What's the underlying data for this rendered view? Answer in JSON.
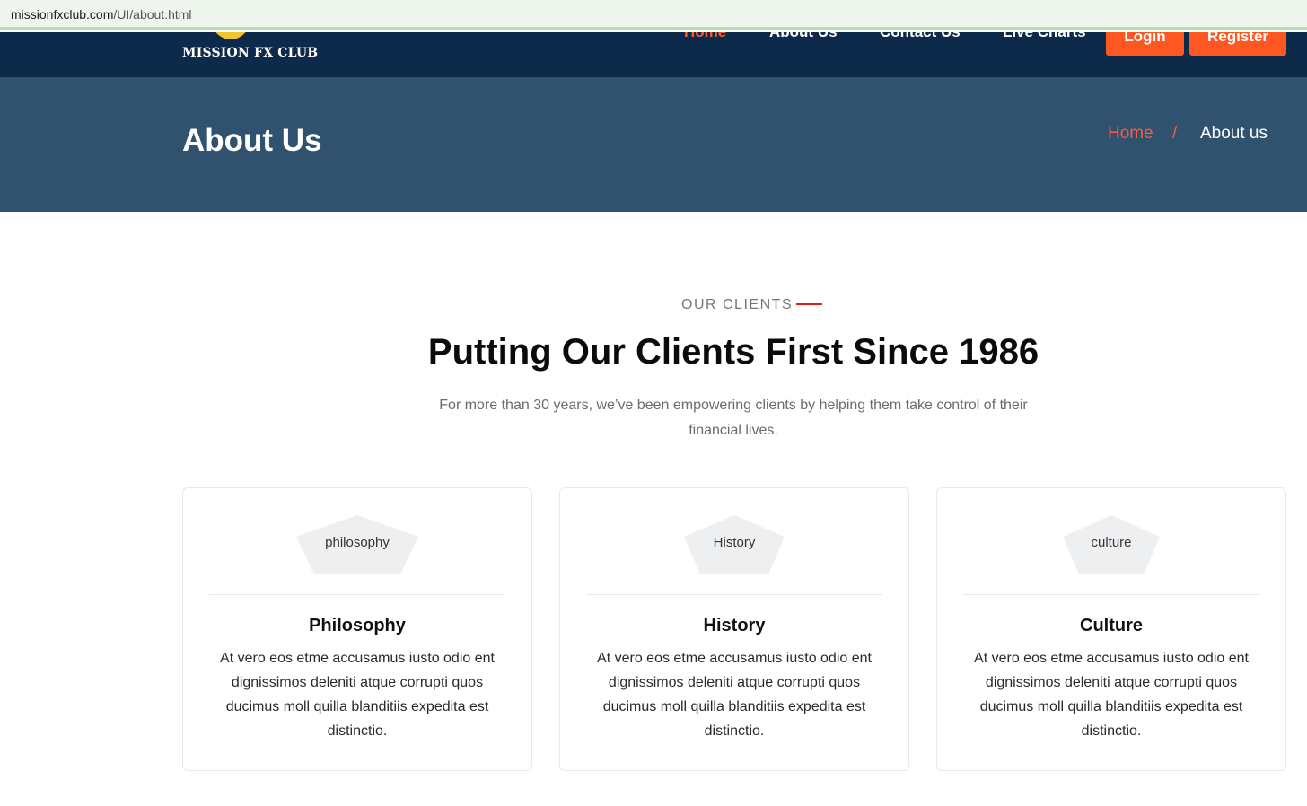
{
  "browser": {
    "url_host": "missionfxclub.com",
    "url_path": "/UI/about.html"
  },
  "nav": {
    "logo_text": "MISSION FX CLUB",
    "links": [
      "Home",
      "About Us",
      "Contact Us",
      "Live Charts"
    ],
    "login_label": "Login",
    "register_label": "Register",
    "active_color": "#ff5a2c",
    "background_color": "#0d2a4a"
  },
  "hero": {
    "title": "About Us",
    "breadcrumb": {
      "home": "Home",
      "separator": "/",
      "current": "About us"
    },
    "background_color": "#30526e"
  },
  "section": {
    "eyebrow": "OUR CLIENTS",
    "title": "Putting Our Clients First Since 1986",
    "intro": "For more than 30 years, we’ve been empowering clients by helping them take control of their financial lives."
  },
  "cards": [
    {
      "image_alt": "philosophy",
      "title": "Philosophy",
      "text": "At vero eos etme accusamus iusto odio ent dignissimos deleniti atque corrupti quos ducimus moll quilla blanditiis expedita est distinctio."
    },
    {
      "image_alt": "History",
      "title": "History",
      "text": "At vero eos etme accusamus iusto odio ent dignissimos deleniti atque corrupti quos ducimus moll quilla blanditiis expedita est distinctio."
    },
    {
      "image_alt": "culture",
      "title": "Culture",
      "text": "At vero eos etme accusamus iusto odio ent dignissimos deleniti atque corrupti quos ducimus moll quilla blanditiis expedita est distinctio."
    }
  ],
  "accent_color": "#ff5722"
}
